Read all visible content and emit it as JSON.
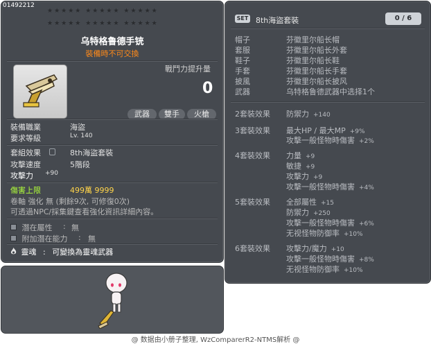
{
  "item_id": "01492212",
  "stars_row1": "★★★★★ ★★★★★ ★★★★★",
  "stars_row2": "★★★★★ ★★★★★ ★★★★★",
  "item_name": "乌特格鲁德手铳",
  "trade_note": "裝備時不可交換",
  "combat_power": {
    "label": "戰鬥力提升量",
    "value": "0"
  },
  "tags": [
    "武器",
    "雙手",
    "火槍"
  ],
  "job": {
    "label": "裝備職業",
    "value": "海盜"
  },
  "level": {
    "label": "要求等級",
    "value": "Lv. 140"
  },
  "set_effect": {
    "label": "套組效果",
    "value": "8th海盜套裝"
  },
  "attack_speed": {
    "label": "攻擊速度",
    "value": "5階段"
  },
  "attack": {
    "label": "攻擊力",
    "value": "+90"
  },
  "damage_cap": {
    "label": "傷害上限",
    "value": "499萬 9999"
  },
  "scroll_text": "卷軸 強化 無 (剩餘9次, 可修復0次)",
  "npc_text": "可透過NPC/採集鍵查看強化資訊詳細內容。",
  "potential": {
    "label": "潛在屬性",
    "sep": ":",
    "value": "無"
  },
  "bonus_potential": {
    "label": "附加潛在能力",
    "sep": ":",
    "value": "無"
  },
  "soul": {
    "label": "靈魂",
    "sep": ":",
    "text": "可變換為靈魂武器"
  },
  "set_panel": {
    "badge": "SET",
    "name": "8th海盜套裝",
    "count": "0 / 6",
    "pieces": [
      {
        "slot": "帽子",
        "name": "芬徽里尔船长帽"
      },
      {
        "slot": "套服",
        "name": "芬徽里尔船长外套"
      },
      {
        "slot": "鞋子",
        "name": "芬徽里尔船长鞋"
      },
      {
        "slot": "手套",
        "name": "芬徽里尔船长手套"
      },
      {
        "slot": "披風",
        "name": "芬徽里尔船长披风"
      },
      {
        "slot": "武器",
        "name": "乌特格鲁德武器中选择1个"
      }
    ],
    "effects": [
      {
        "header": "2套裝效果",
        "lines": [
          {
            "stat": "防禦力",
            "value": "+140"
          }
        ]
      },
      {
        "header": "3套裝效果",
        "lines": [
          {
            "stat": "最大HP / 最大MP",
            "value": "+9%"
          },
          {
            "stat": "攻擊一般怪物時傷害",
            "value": "+2%"
          }
        ]
      },
      {
        "header": "4套裝效果",
        "lines": [
          {
            "stat": "力量",
            "value": "+9"
          },
          {
            "stat": "敏捷",
            "value": "+9"
          },
          {
            "stat": "攻擊力",
            "value": "+9"
          },
          {
            "stat": "攻擊一般怪物時傷害",
            "value": "+4%"
          }
        ]
      },
      {
        "header": "5套裝效果",
        "lines": [
          {
            "stat": "全部屬性",
            "value": "+15"
          },
          {
            "stat": "防禦力",
            "value": "+250"
          },
          {
            "stat": "攻擊一般怪物時傷害",
            "value": "+6%"
          },
          {
            "stat": "无视怪物防御率",
            "value": "+10%"
          }
        ]
      },
      {
        "header": "6套裝效果",
        "lines": [
          {
            "stat": "攻擊力/魔力",
            "value": "+10"
          },
          {
            "stat": "攻擊一般怪物時傷害",
            "value": "+8%"
          },
          {
            "stat": "无视怪物防御率",
            "value": "+10%"
          }
        ]
      }
    ]
  },
  "footer": "@ 数据由小册子整理, WzComparerR2-NTMS解析 @",
  "colors": {
    "panel": "#45494f",
    "gold": "#ffd44a",
    "green": "#b2ff3a",
    "orange": "#ff8a1a"
  },
  "icons": {
    "weapon": "golden-hand-cannon",
    "soul": "flame-icon",
    "potential": "square-bullet-icon"
  }
}
